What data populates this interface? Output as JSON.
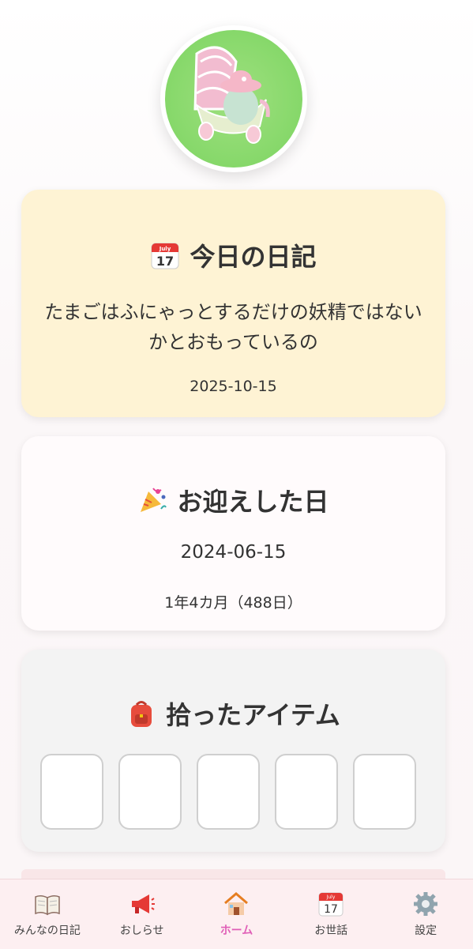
{
  "diary": {
    "title": "今日の日記",
    "text": "たまごはふにゃっとするだけの妖精ではないかとおもっているの",
    "date": "2025-10-15",
    "calendar_icon_month": "July",
    "calendar_icon_day": "17"
  },
  "welcome": {
    "title": "お迎えした日",
    "date": "2024-06-15",
    "duration": "1年4カ月（488日）"
  },
  "items": {
    "title": "拾ったアイテム",
    "slots": [
      "",
      "",
      "",
      "",
      ""
    ]
  },
  "nav": {
    "items": [
      {
        "label": "みんなの日記",
        "icon": "book-icon"
      },
      {
        "label": "おしらせ",
        "icon": "megaphone-icon"
      },
      {
        "label": "ホーム",
        "icon": "house-icon",
        "active": true
      },
      {
        "label": "お世話",
        "icon": "calendar-icon"
      },
      {
        "label": "設定",
        "icon": "gear-icon"
      }
    ]
  },
  "colors": {
    "accent": "#e05fb7",
    "diary_card": "#fef3d4",
    "items_card": "#f3f3f3"
  }
}
